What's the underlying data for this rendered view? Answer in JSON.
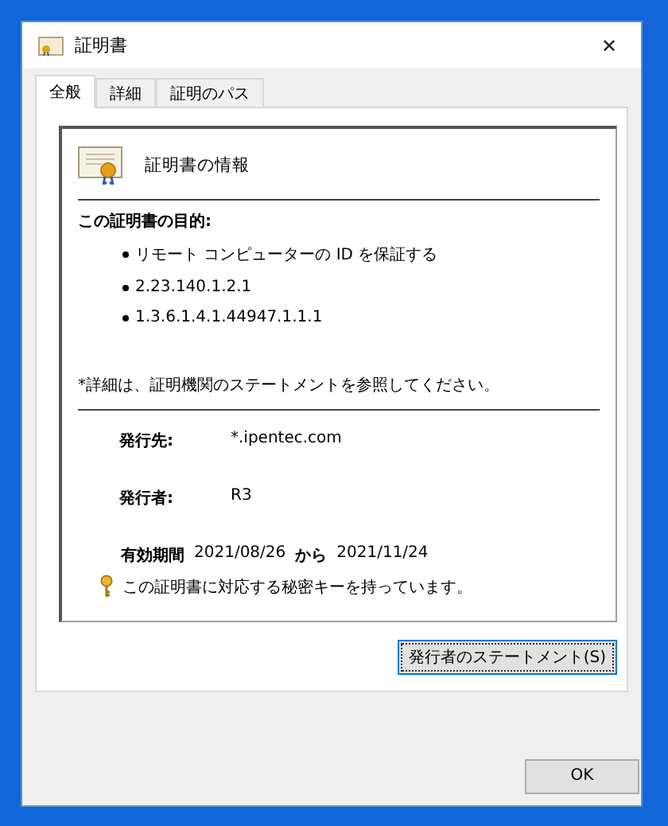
{
  "window": {
    "title": "証明書",
    "close": "✕"
  },
  "tabs": [
    {
      "label": "全般",
      "selected": true
    },
    {
      "label": "詳細",
      "selected": false
    },
    {
      "label": "証明のパス",
      "selected": false
    }
  ],
  "certificate": {
    "heading": "証明書の情報",
    "purpose_title": "この証明書の目的:",
    "purposes": [
      "リモート コンピューターの ID を保証する",
      "2.23.140.1.2.1",
      "1.3.6.1.4.1.44947.1.1.1"
    ],
    "note": "*詳細は、証明機関のステートメントを参照してください。",
    "issued_to_label": "発行先:",
    "issued_to": "*.ipentec.com",
    "issued_by_label": "発行者:",
    "issued_by": "R3",
    "validity_label": "有効期間",
    "valid_from": "2021/08/26",
    "validity_join": "から",
    "valid_to": "2021/11/24",
    "key_note": "この証明書に対応する秘密キーを持っています。"
  },
  "statement_button": "発行者のステートメント(S)",
  "ok_button": "OK"
}
